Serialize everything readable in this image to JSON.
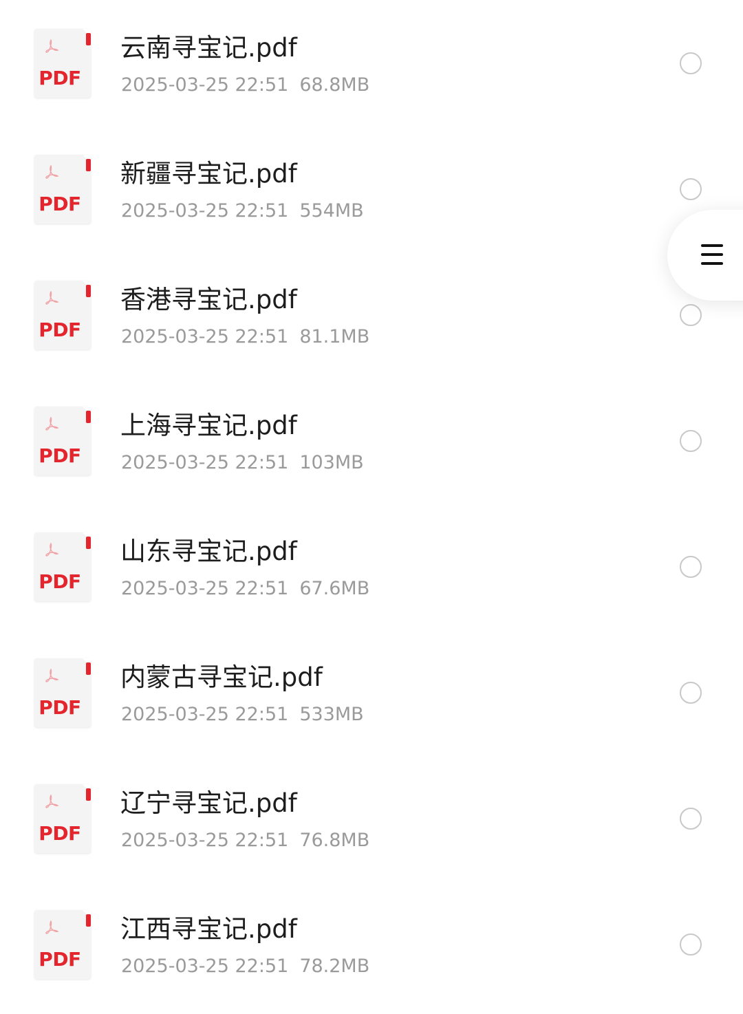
{
  "files": [
    {
      "name": "云南寻宝记.pdf",
      "datetime": "2025-03-25 22:51",
      "size": "68.8MB",
      "icon_label": "PDF"
    },
    {
      "name": "新疆寻宝记.pdf",
      "datetime": "2025-03-25 22:51",
      "size": "554MB",
      "icon_label": "PDF"
    },
    {
      "name": "香港寻宝记.pdf",
      "datetime": "2025-03-25 22:51",
      "size": "81.1MB",
      "icon_label": "PDF"
    },
    {
      "name": "上海寻宝记.pdf",
      "datetime": "2025-03-25 22:51",
      "size": "103MB",
      "icon_label": "PDF"
    },
    {
      "name": "山东寻宝记.pdf",
      "datetime": "2025-03-25 22:51",
      "size": "67.6MB",
      "icon_label": "PDF"
    },
    {
      "name": "内蒙古寻宝记.pdf",
      "datetime": "2025-03-25 22:51",
      "size": "533MB",
      "icon_label": "PDF"
    },
    {
      "name": "辽宁寻宝记.pdf",
      "datetime": "2025-03-25 22:51",
      "size": "76.8MB",
      "icon_label": "PDF"
    },
    {
      "name": "江西寻宝记.pdf",
      "datetime": "2025-03-25 22:51",
      "size": "78.2MB",
      "icon_label": "PDF"
    }
  ],
  "icons": {
    "file_icon": "pdf-file-icon",
    "select": "radio-unchecked-icon",
    "floating_menu": "hamburger-menu-icon"
  },
  "colors": {
    "pdf_red": "#e3252d",
    "name_text": "#1d1d1d",
    "meta_text": "#9a9a9a",
    "radio_border": "#c8c8c8"
  }
}
